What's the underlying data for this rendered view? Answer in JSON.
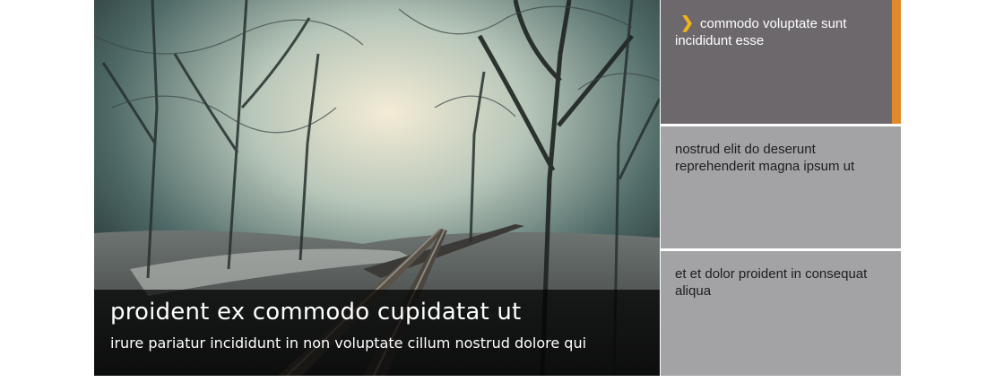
{
  "slider": {
    "caption": {
      "title": "proident ex commodo cupidatat ut",
      "subtitle": "irure pariatur incididunt in non voluptate cillum nostrud dolore qui"
    },
    "tabs": [
      {
        "label": "commodo voluptate sunt incididunt esse",
        "active": true
      },
      {
        "label": "nostrud elit do deserunt reprehenderit magna ipsum ut",
        "active": false
      },
      {
        "label": "et et dolor proident in consequat aliqua",
        "active": false
      }
    ],
    "colors": {
      "active_tab": "#6d686c",
      "inactive_tab": "#a3a3a6",
      "accent_bar": "#e08a2a",
      "chevron": "#f2b21a"
    },
    "icons": {
      "active_indicator": "chevron-right-icon"
    }
  }
}
